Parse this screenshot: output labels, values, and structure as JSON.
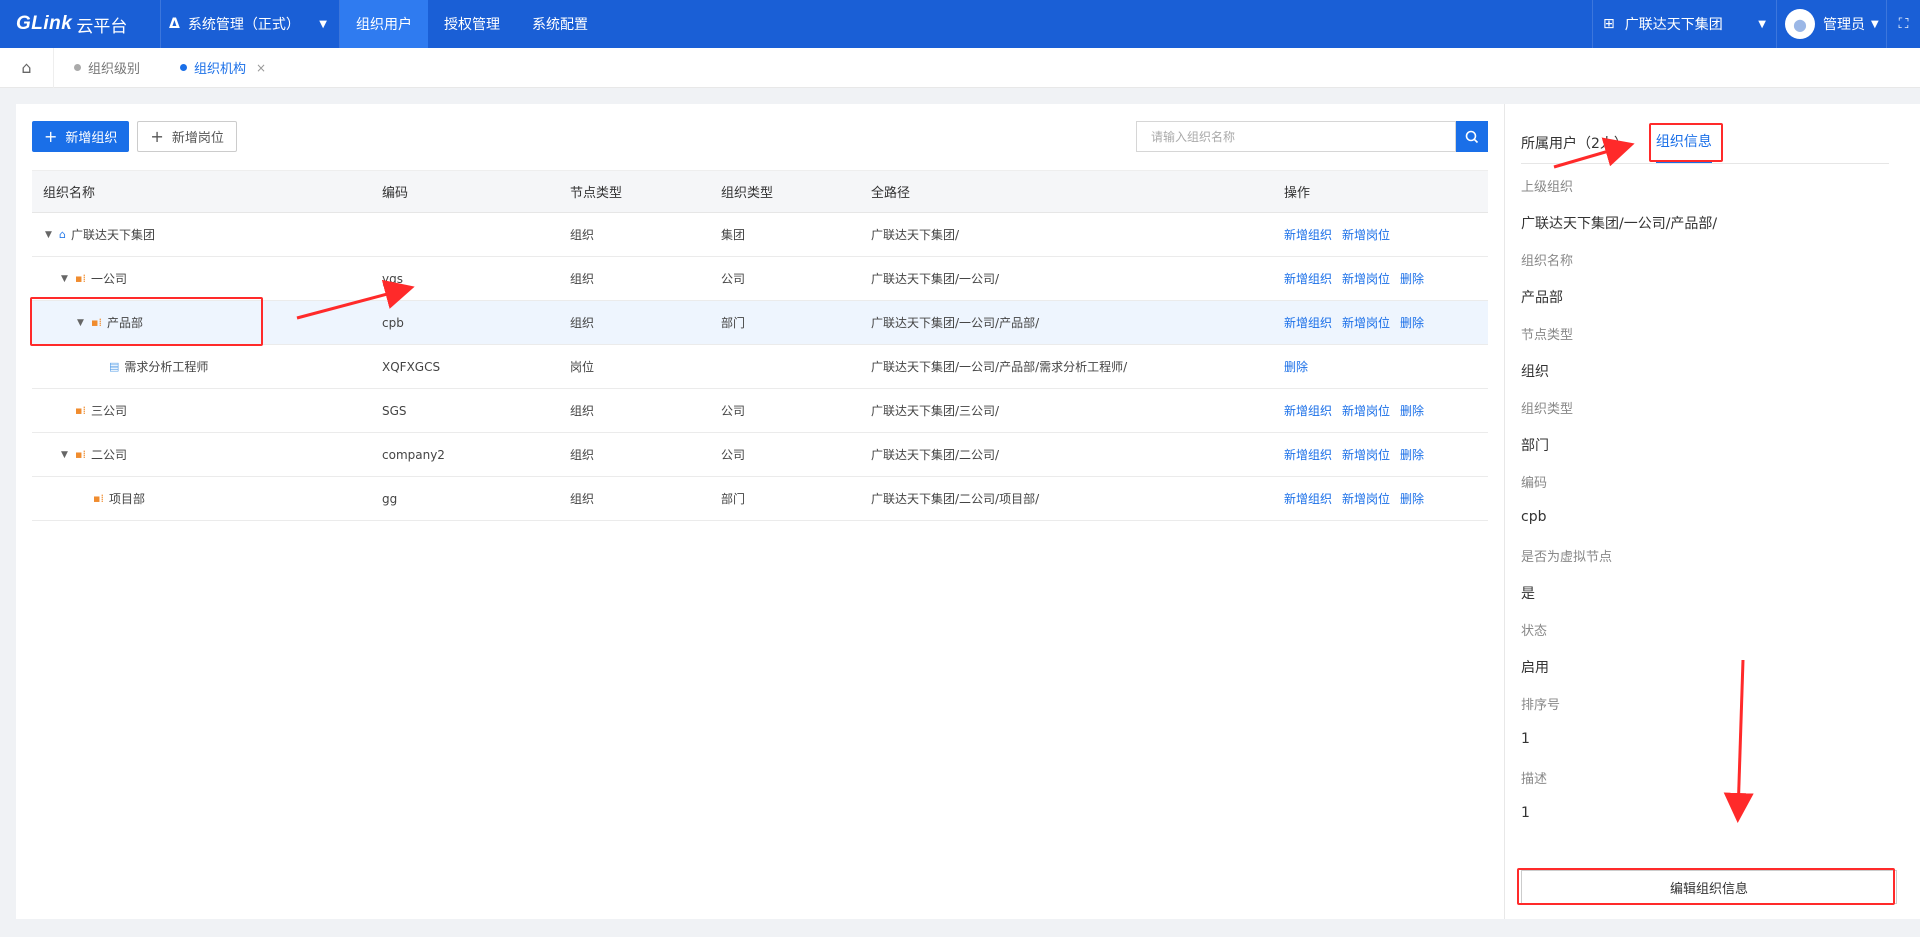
{
  "topbar": {
    "logo_brand": "GLink",
    "logo_suffix": "云平台",
    "system": "系统管理（正式）",
    "nav": [
      "组织用户",
      "授权管理",
      "系统配置"
    ],
    "org": "广联达天下集团",
    "user": "管理员"
  },
  "tabs": [
    {
      "label": "组织级别"
    },
    {
      "label": "组织机构",
      "close": "×"
    }
  ],
  "toolbar": {
    "add_org": "新增组织",
    "add_post": "新增岗位",
    "search_placeholder": "请输入组织名称"
  },
  "table": {
    "headers": [
      "组织名称",
      "编码",
      "节点类型",
      "组织类型",
      "全路径",
      "操作"
    ],
    "rows": [
      {
        "name": "广联达天下集团",
        "code": "",
        "node_type": "组织",
        "org_type": "集团",
        "path": "广联达天下集团/",
        "ops": [
          "新增组织",
          "新增岗位"
        ]
      },
      {
        "name": "一公司",
        "code": "ygs",
        "node_type": "组织",
        "org_type": "公司",
        "path": "广联达天下集团/一公司/",
        "ops": [
          "新增组织",
          "新增岗位",
          "删除"
        ]
      },
      {
        "name": "产品部",
        "code": "cpb",
        "node_type": "组织",
        "org_type": "部门",
        "path": "广联达天下集团/一公司/产品部/",
        "ops": [
          "新增组织",
          "新增岗位",
          "删除"
        ]
      },
      {
        "name": "需求分析工程师",
        "code": "XQFXGCS",
        "node_type": "岗位",
        "org_type": "",
        "path": "广联达天下集团/一公司/产品部/需求分析工程师/",
        "ops": [
          "删除"
        ]
      },
      {
        "name": "三公司",
        "code": "SGS",
        "node_type": "组织",
        "org_type": "公司",
        "path": "广联达天下集团/三公司/",
        "ops": [
          "新增组织",
          "新增岗位",
          "删除"
        ]
      },
      {
        "name": "二公司",
        "code": "company2",
        "node_type": "组织",
        "org_type": "公司",
        "path": "广联达天下集团/二公司/",
        "ops": [
          "新增组织",
          "新增岗位",
          "删除"
        ]
      },
      {
        "name": "项目部",
        "code": "gg",
        "node_type": "组织",
        "org_type": "部门",
        "path": "广联达天下集团/二公司/项目部/",
        "ops": [
          "新增组织",
          "新增岗位",
          "删除"
        ]
      }
    ]
  },
  "side": {
    "tab_users": "所属用户（2人）",
    "tab_info": "组织信息",
    "fields": [
      {
        "label": "上级组织",
        "value": "广联达天下集团/一公司/产品部/"
      },
      {
        "label": "组织名称",
        "value": "产品部"
      },
      {
        "label": "节点类型",
        "value": "组织"
      },
      {
        "label": "组织类型",
        "value": "部门"
      },
      {
        "label": "编码",
        "value": "cpb"
      },
      {
        "label": "是否为虚拟节点",
        "value": "是"
      },
      {
        "label": "状态",
        "value": "启用"
      },
      {
        "label": "排序号",
        "value": "1"
      },
      {
        "label": "描述",
        "value": "1"
      }
    ],
    "edit_button": "编辑组织信息"
  },
  "colors": {
    "nav_bg": "#1a5fd6",
    "nav_active": "#2f7bf0",
    "primary": "#1a6fe8",
    "annotation": "#ff2a2a"
  }
}
